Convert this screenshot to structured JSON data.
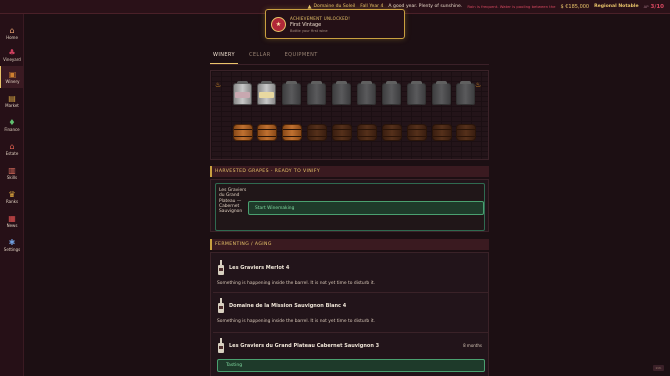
{
  "topbar": {
    "estate": "Domaine du Soleil",
    "season": "Fall",
    "week": "Year 4",
    "weather": "A good year. Plenty of sunshine.",
    "event": "Rain is frequent. Water is pooling between the",
    "money": "€185,000",
    "rank": "Regional Notable",
    "ap_label": "AP",
    "ap_value": "3/10"
  },
  "sidebar": {
    "items": [
      {
        "label": "Home",
        "icon": "home-icon"
      },
      {
        "label": "Vineyard",
        "icon": "vine-icon"
      },
      {
        "label": "Winery",
        "icon": "barrel-icon"
      },
      {
        "label": "Market",
        "icon": "market-icon"
      },
      {
        "label": "Finance",
        "icon": "finance-icon"
      },
      {
        "label": "Estate",
        "icon": "estate-icon"
      },
      {
        "label": "Skills",
        "icon": "skills-icon"
      },
      {
        "label": "Ranks",
        "icon": "trophy-icon"
      },
      {
        "label": "News",
        "icon": "news-icon"
      },
      {
        "label": "Settings",
        "icon": "gear-icon"
      }
    ],
    "active": "Winery"
  },
  "toast": {
    "title": "ACHIEVEMENT UNLOCKED!",
    "name": "First Vintage",
    "desc": "Bottle your first wine"
  },
  "tabs": [
    "WINERY",
    "CELLAR",
    "EQUIPMENT"
  ],
  "active_tab": "WINERY",
  "harvest": {
    "title": "HARVESTED GRAPES - READY TO VINIFY",
    "grape": "Les Graviers du Grand Plateau — Cabernet Sauvignon",
    "button": "Start Winemaking"
  },
  "ferment": {
    "title": "FERMENTING / AGING",
    "items": [
      {
        "name": "Les Graviers Merlot 4",
        "status": "Something is happening inside the barrel. It is not yet time to disturb it.",
        "time": ""
      },
      {
        "name": "Domaine de la Mission Sauvignon Blanc 4",
        "status": "Something is happening inside the barrel. It is not yet time to disturb it.",
        "time": ""
      },
      {
        "name": "Les Graviers du Grand Plateau Cabernet Sauvignon 3",
        "status": "",
        "time": "8 months"
      }
    ],
    "taste_button": "Tasting"
  },
  "corner_badge": "Info"
}
